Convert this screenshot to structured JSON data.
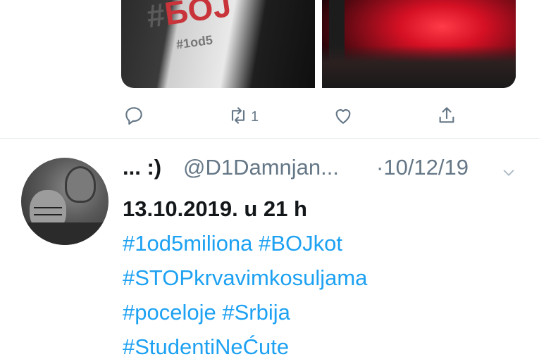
{
  "prev_tweet": {
    "media_left": {
      "sign_prefix": "#",
      "sign_word": "БОЈ",
      "sign_small": "#1od5"
    },
    "actions": {
      "reply_icon": "reply-icon",
      "retweet_icon": "retweet-icon",
      "retweet_count": "1",
      "like_icon": "heart-icon",
      "share_icon": "share-icon"
    }
  },
  "tweet": {
    "display_name": "... :)",
    "handle": "@D1Damnjan...",
    "date": "·10/12/19",
    "line1": "13.10.2019. u 21 h",
    "hashtags_line2": [
      "#1od5miliona",
      "#BOJkot"
    ],
    "hashtags_line3": [
      "#STOPkrvavimkosuljama"
    ],
    "hashtags_line4": [
      "#poceloje",
      "#Srbija"
    ],
    "hashtags_line5": [
      "#StudentiNeĆute"
    ]
  },
  "colors": {
    "link": "#1da1f2",
    "muted": "#657786",
    "text": "#14171a"
  }
}
